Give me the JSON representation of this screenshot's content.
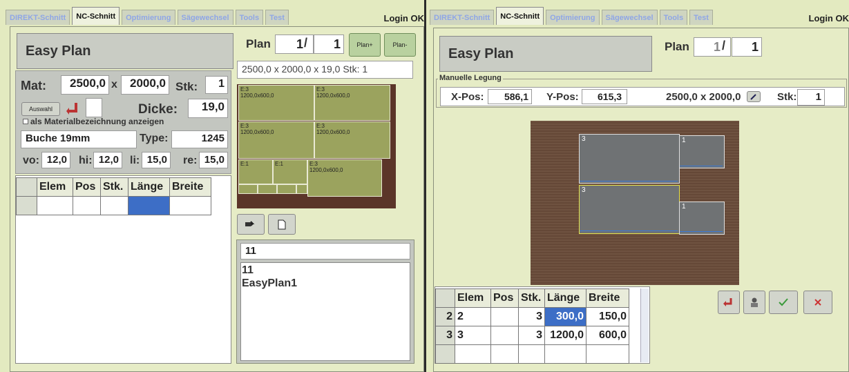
{
  "tabs": [
    "DIREKT-Schnitt",
    "NC-Schnitt",
    "Optimierung",
    "Sägewechsel",
    "Tools",
    "Test"
  ],
  "login": "Login OK",
  "left": {
    "title": "Easy Plan",
    "plan_label": "Plan",
    "plan_current": "1",
    "plan_sep": "/",
    "plan_total": "1",
    "plan_next": "Plan+",
    "plan_prev": "Plan-",
    "plan_info": "2500,0 x 2000,0 x 19,0 Stk: 1",
    "mat_label": "Mat:",
    "mat_x": "2500,0",
    "mat_sep": "x",
    "mat_y": "2000,0",
    "stk_label": "Stk:",
    "stk": "1",
    "auswahl": "Auswahl",
    "dicke_label": "Dicke:",
    "dicke": "19,0",
    "checkbox_label": "als Materialbezeichnung anzeigen",
    "material_name": "Buche 19mm",
    "type_label": "Type:",
    "type": "1245",
    "vo_label": "vo:",
    "vo": "12,0",
    "hi_label": "hi:",
    "hi": "12,0",
    "li_label": "li:",
    "li": "15,0",
    "re_label": "re:",
    "re": "15,0",
    "table_headers": [
      "Elem",
      "Pos",
      "Stk.",
      "Länge",
      "Breite"
    ],
    "preview_parts": [
      {
        "l1": "E:3",
        "l2": "1200,0x600,0"
      },
      {
        "l1": "E:3",
        "l2": "1200,0x600,0"
      },
      {
        "l1": "E:3",
        "l2": "1200,0x600,0"
      },
      {
        "l1": "E:3",
        "l2": "1200,0x600,0"
      },
      {
        "l1": "E:1",
        "l2": ""
      },
      {
        "l1": "E:1",
        "l2": ""
      },
      {
        "l1": "E:3",
        "l2": "1200,0x600,0"
      }
    ],
    "plan_name_input": "11",
    "plan_list": [
      "11",
      "EasyPlan1"
    ]
  },
  "right": {
    "title": "Easy Plan",
    "plan_label": "Plan",
    "plan_current": "1",
    "plan_sep": "/",
    "plan_total": "1",
    "group_label": "Manuelle Legung",
    "xpos_label": "X-Pos:",
    "xpos": "586,1",
    "ypos_label": "Y-Pos:",
    "ypos": "615,3",
    "size": "2500,0 x 2000,0",
    "stk_label": "Stk:",
    "stk": "1",
    "parts": [
      {
        "label": "3"
      },
      {
        "label": "1"
      },
      {
        "label": "3"
      },
      {
        "label": "1"
      }
    ],
    "table_headers": [
      "Elem",
      "Pos",
      "Stk.",
      "Länge",
      "Breite"
    ],
    "rows": [
      {
        "idx": "2",
        "elem": "2",
        "pos": "",
        "stk": "3",
        "laenge": "300,0",
        "breite": "150,0"
      },
      {
        "idx": "3",
        "elem": "3",
        "pos": "",
        "stk": "3",
        "laenge": "1200,0",
        "breite": "600,0"
      }
    ]
  },
  "colors": {
    "accent": "#3d6ec6",
    "panel": "#e3eac0",
    "wood": "#6a4c3a",
    "part": "#9ba35e"
  }
}
